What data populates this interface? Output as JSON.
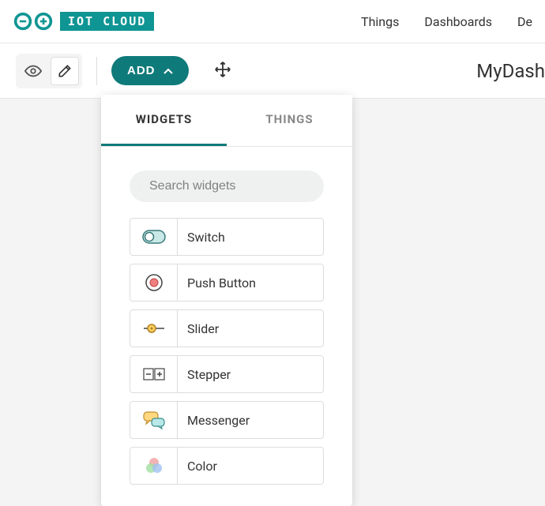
{
  "brand": {
    "label": "IOT CLOUD"
  },
  "nav": {
    "things": "Things",
    "dashboards": "Dashboards",
    "de": "De"
  },
  "toolbar": {
    "add_label": "ADD",
    "dashboard_title": "MyDash"
  },
  "dropdown": {
    "tabs": {
      "widgets": "WIDGETS",
      "things": "THINGS"
    },
    "search": {
      "placeholder": "Search widgets"
    },
    "widgets": [
      {
        "id": "switch",
        "label": "Switch"
      },
      {
        "id": "push_button",
        "label": "Push Button"
      },
      {
        "id": "slider",
        "label": "Slider"
      },
      {
        "id": "stepper",
        "label": "Stepper"
      },
      {
        "id": "messenger",
        "label": "Messenger"
      },
      {
        "id": "color",
        "label": "Color"
      }
    ]
  },
  "colors": {
    "accent": "#0f7a7a",
    "teal": "#0f9593"
  }
}
